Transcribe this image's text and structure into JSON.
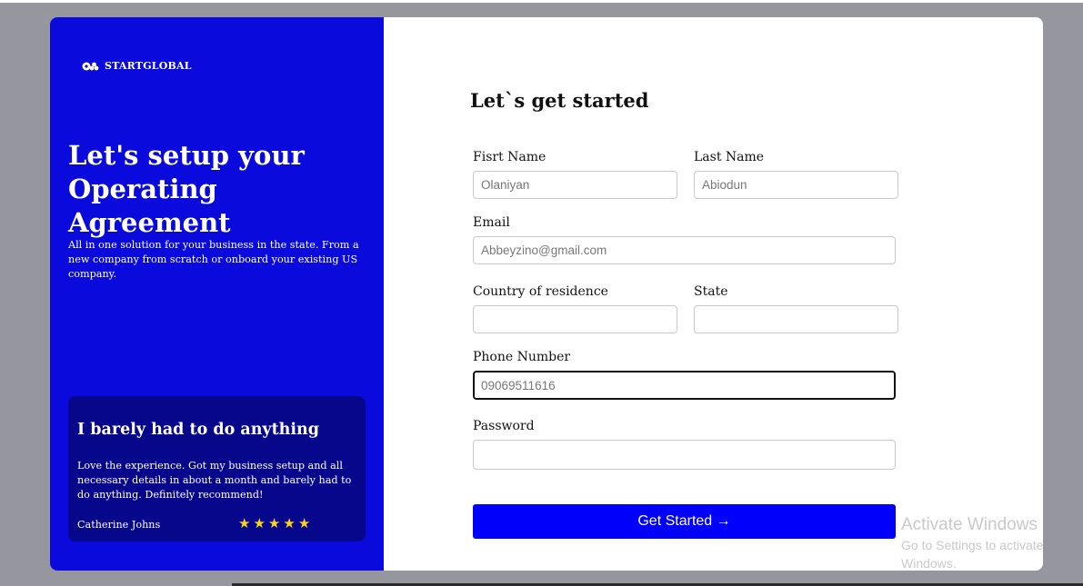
{
  "brand": {
    "name": "STARTGLOBAL",
    "logo_icon": "logo-mark-icon"
  },
  "hero": {
    "title": "Let's setup your Operating Agreement",
    "subtitle": "All in one solution for your business in the state. From a new company from scratch or onboard your existing US company."
  },
  "testimonial": {
    "title": "I barely had to do anything",
    "body": "Love the experience. Got my business setup and all necessary details in about a month and barely had to do anything. Definitely recommend!",
    "author": "Catherine Johns",
    "rating": 5,
    "stars": [
      "★",
      "★",
      "★",
      "★",
      "★"
    ]
  },
  "form": {
    "title": "Let`s get started",
    "first_name": {
      "label": "Fisrt Name",
      "placeholder": "Olaniyan"
    },
    "last_name": {
      "label": "Last Name",
      "placeholder": "Abiodun"
    },
    "email": {
      "label": "Email",
      "placeholder": "Abbeyzino@gmail.com"
    },
    "country": {
      "label": "Country of residence",
      "placeholder": ""
    },
    "state": {
      "label": "State",
      "placeholder": ""
    },
    "phone": {
      "label": "Phone Number",
      "placeholder": "09069511616"
    },
    "password": {
      "label": "Password",
      "placeholder": ""
    },
    "submit_label": "Get Started →"
  },
  "watermark": {
    "line1": "Activate Windows",
    "line2": "Go to Settings to activate Windows."
  },
  "colors": {
    "panel": "#0a0adc",
    "testimonial_bg": "#07078c",
    "button": "#0000fb",
    "star": "#ffd21e",
    "backdrop": "#96969e"
  }
}
